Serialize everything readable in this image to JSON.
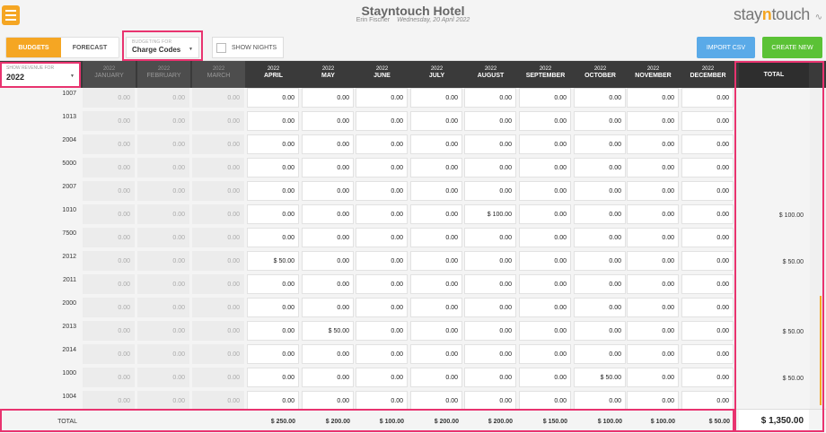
{
  "app": {
    "hotel_name": "Stayntouch Hotel",
    "user": "Erin Fischer",
    "date": "Wednesday, 20 April 2022",
    "logo_pre": "stay",
    "logo_n": "n",
    "logo_post": "touch",
    "logo_icon": "∿"
  },
  "toolbar": {
    "budgets_label": "BUDGETS",
    "forecast_label": "FORECAST",
    "budgeting_for_label": "BUDGETING FOR",
    "budgeting_for_value": "Charge Codes",
    "show_nights_label": "SHOW NIGHTS",
    "import_label": "IMPORT CSV",
    "create_label": "CREATE NEW",
    "colors": {
      "orange": "#f5a623",
      "blue": "#5aaae8",
      "green": "#5bc236",
      "highlight": "#e8336f"
    }
  },
  "filter": {
    "label": "SHOW REVENUE FOR",
    "value": "2022"
  },
  "months": [
    {
      "year": "2022",
      "name": "JANUARY",
      "disabled": true
    },
    {
      "year": "2022",
      "name": "FEBRUARY",
      "disabled": true
    },
    {
      "year": "2022",
      "name": "MARCH",
      "disabled": true
    },
    {
      "year": "2022",
      "name": "APRIL",
      "disabled": false
    },
    {
      "year": "2022",
      "name": "MAY",
      "disabled": false
    },
    {
      "year": "2022",
      "name": "JUNE",
      "disabled": false
    },
    {
      "year": "2022",
      "name": "JULY",
      "disabled": false
    },
    {
      "year": "2022",
      "name": "AUGUST",
      "disabled": false
    },
    {
      "year": "2022",
      "name": "SEPTEMBER",
      "disabled": false
    },
    {
      "year": "2022",
      "name": "OCTOBER",
      "disabled": false
    },
    {
      "year": "2022",
      "name": "NOVEMBER",
      "disabled": false
    },
    {
      "year": "2022",
      "name": "DECEMBER",
      "disabled": false
    }
  ],
  "total_header": "TOTAL",
  "rows": [
    {
      "code": "1007",
      "values": [
        "0.00",
        "0.00",
        "0.00",
        "0.00",
        "0.00",
        "0.00",
        "0.00",
        "0.00",
        "0.00",
        "0.00",
        "0.00",
        "0.00"
      ],
      "total": ""
    },
    {
      "code": "1013",
      "values": [
        "0.00",
        "0.00",
        "0.00",
        "0.00",
        "0.00",
        "0.00",
        "0.00",
        "0.00",
        "0.00",
        "0.00",
        "0.00",
        "0.00"
      ],
      "total": ""
    },
    {
      "code": "2004",
      "values": [
        "0.00",
        "0.00",
        "0.00",
        "0.00",
        "0.00",
        "0.00",
        "0.00",
        "0.00",
        "0.00",
        "0.00",
        "0.00",
        "0.00"
      ],
      "total": ""
    },
    {
      "code": "5000",
      "values": [
        "0.00",
        "0.00",
        "0.00",
        "0.00",
        "0.00",
        "0.00",
        "0.00",
        "0.00",
        "0.00",
        "0.00",
        "0.00",
        "0.00"
      ],
      "total": ""
    },
    {
      "code": "2007",
      "values": [
        "0.00",
        "0.00",
        "0.00",
        "0.00",
        "0.00",
        "0.00",
        "0.00",
        "0.00",
        "0.00",
        "0.00",
        "0.00",
        "0.00"
      ],
      "total": ""
    },
    {
      "code": "1010",
      "values": [
        "0.00",
        "0.00",
        "0.00",
        "0.00",
        "0.00",
        "0.00",
        "0.00",
        "$ 100.00",
        "0.00",
        "0.00",
        "0.00",
        "0.00"
      ],
      "total": "$ 100.00"
    },
    {
      "code": "7500",
      "values": [
        "0.00",
        "0.00",
        "0.00",
        "0.00",
        "0.00",
        "0.00",
        "0.00",
        "0.00",
        "0.00",
        "0.00",
        "0.00",
        "0.00"
      ],
      "total": ""
    },
    {
      "code": "2012",
      "values": [
        "0.00",
        "0.00",
        "0.00",
        "$ 50.00",
        "0.00",
        "0.00",
        "0.00",
        "0.00",
        "0.00",
        "0.00",
        "0.00",
        "0.00"
      ],
      "total": "$ 50.00"
    },
    {
      "code": "2011",
      "values": [
        "0.00",
        "0.00",
        "0.00",
        "0.00",
        "0.00",
        "0.00",
        "0.00",
        "0.00",
        "0.00",
        "0.00",
        "0.00",
        "0.00"
      ],
      "total": ""
    },
    {
      "code": "2000",
      "values": [
        "0.00",
        "0.00",
        "0.00",
        "0.00",
        "0.00",
        "0.00",
        "0.00",
        "0.00",
        "0.00",
        "0.00",
        "0.00",
        "0.00"
      ],
      "total": ""
    },
    {
      "code": "2013",
      "values": [
        "0.00",
        "0.00",
        "0.00",
        "0.00",
        "$ 50.00",
        "0.00",
        "0.00",
        "0.00",
        "0.00",
        "0.00",
        "0.00",
        "0.00"
      ],
      "total": "$ 50.00"
    },
    {
      "code": "2014",
      "values": [
        "0.00",
        "0.00",
        "0.00",
        "0.00",
        "0.00",
        "0.00",
        "0.00",
        "0.00",
        "0.00",
        "0.00",
        "0.00",
        "0.00"
      ],
      "total": ""
    },
    {
      "code": "1000",
      "values": [
        "0.00",
        "0.00",
        "0.00",
        "0.00",
        "0.00",
        "0.00",
        "0.00",
        "0.00",
        "0.00",
        "$ 50.00",
        "0.00",
        "0.00"
      ],
      "total": "$ 50.00"
    },
    {
      "code": "1004",
      "values": [
        "0.00",
        "0.00",
        "0.00",
        "0.00",
        "0.00",
        "0.00",
        "0.00",
        "0.00",
        "0.00",
        "0.00",
        "0.00",
        "0.00"
      ],
      "total": ""
    }
  ],
  "footer": {
    "label": "TOTAL",
    "month_totals": [
      "",
      "",
      "",
      "$ 250.00",
      "$ 200.00",
      "$ 100.00",
      "$ 200.00",
      "$ 200.00",
      "$ 150.00",
      "$ 100.00",
      "$ 100.00",
      "$ 50.00"
    ],
    "grand_total": "$ 1,350.00"
  }
}
